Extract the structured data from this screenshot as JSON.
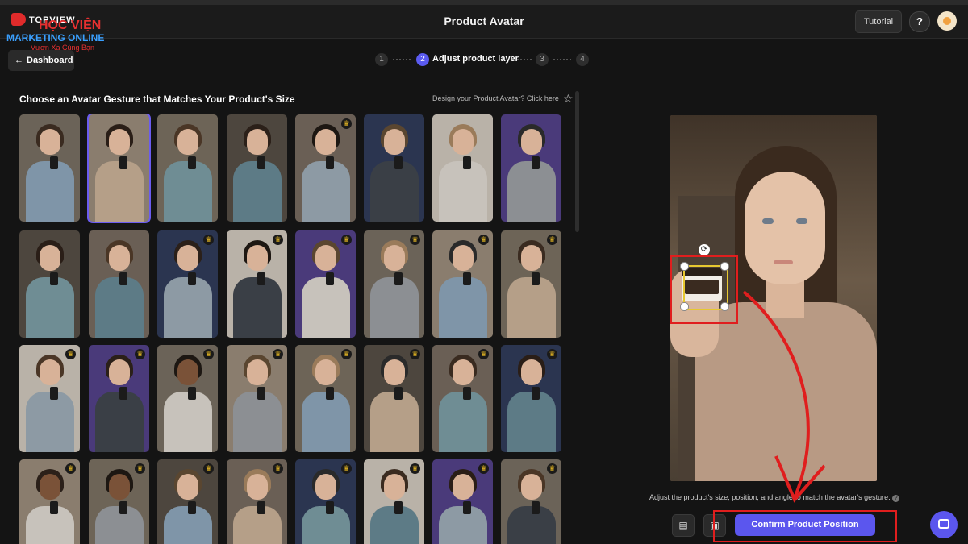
{
  "header": {
    "title": "Product Avatar",
    "tutorial_label": "Tutorial",
    "help_label": "?"
  },
  "watermark": {
    "brand": "TOPVIEW",
    "line1": "HỌC VIỆN",
    "line2": "MARKETING ONLINE",
    "line3": "Vươn Xa Cùng Bạn"
  },
  "nav": {
    "dashboard_label": "Dashboard"
  },
  "steps": {
    "items": [
      "1",
      "2",
      "3",
      "4"
    ],
    "active_index": 1,
    "active_label": "Adjust product layer"
  },
  "gallery": {
    "title": "Choose an Avatar Gesture that Matches Your Product's Size",
    "design_link": "Design your Product Avatar? Click here"
  },
  "preview": {
    "hint": "Adjust the product's size, position, and angle to match the avatar's gesture.",
    "confirm_label": "Confirm Product Position"
  },
  "icons": {
    "back": "arrow-left-icon",
    "star": "star-icon",
    "crown": "crown-icon",
    "rotate": "rotate-icon",
    "info": "info-icon",
    "chat": "chat-icon"
  },
  "colors": {
    "accent": "#5b56ee",
    "crown": "#e8b923",
    "annotation": "#e01e1e"
  }
}
